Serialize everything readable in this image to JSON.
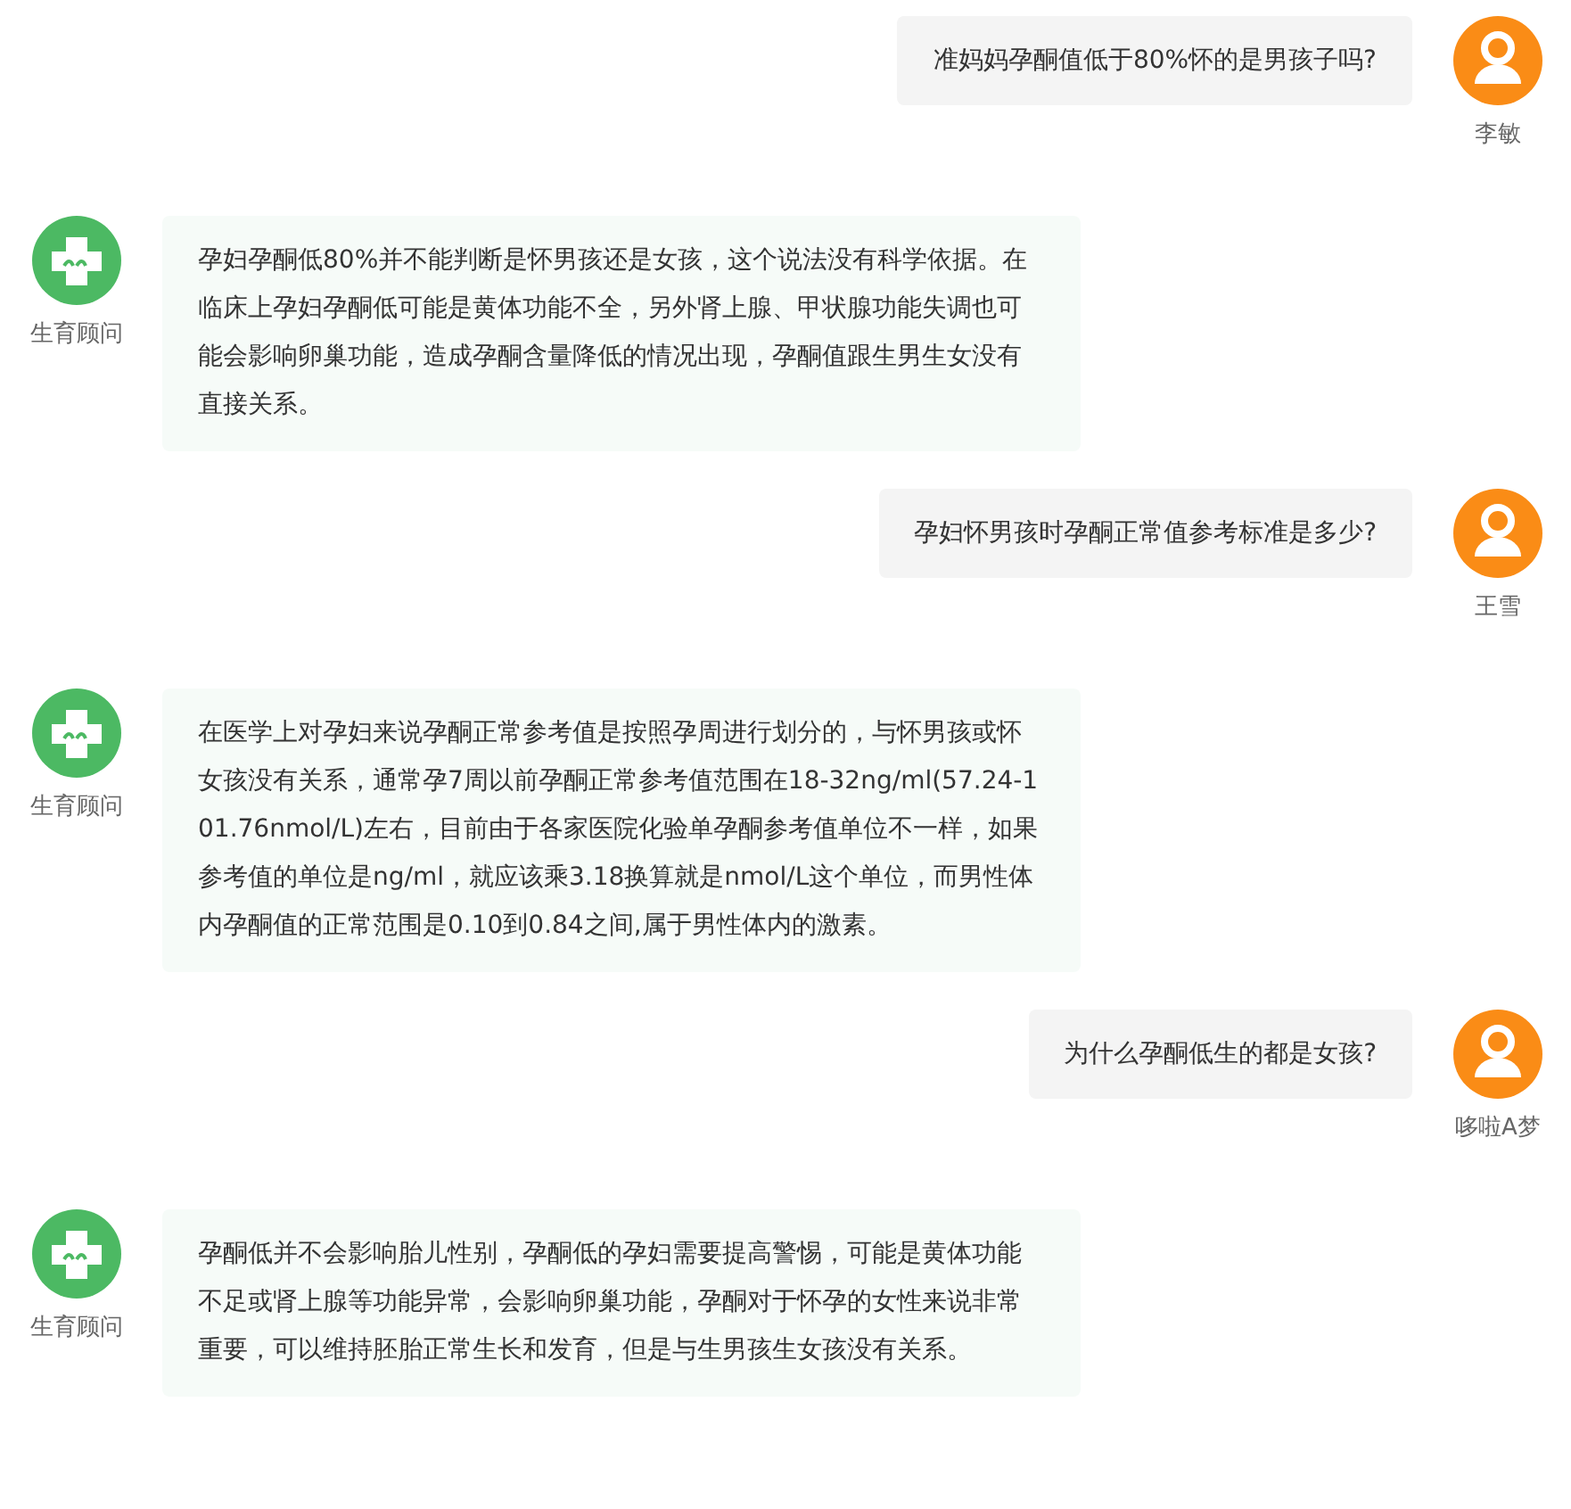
{
  "messages": [
    {
      "kind": "question",
      "text": "准妈妈孕酮值低于80%怀的是男孩子吗?",
      "author": "李敏"
    },
    {
      "kind": "answer",
      "text": "孕妇孕酮低80%并不能判断是怀男孩还是女孩，这个说法没有科学依据。在临床上孕妇孕酮低可能是黄体功能不全，另外肾上腺、甲状腺功能失调也可能会影响卵巢功能，造成孕酮含量降低的情况出现，孕酮值跟生男生女没有直接关系。",
      "author": "生育顾问"
    },
    {
      "kind": "question",
      "text": "孕妇怀男孩时孕酮正常值参考标准是多少?",
      "author": "王雪"
    },
    {
      "kind": "answer",
      "text": "在医学上对孕妇来说孕酮正常参考值是按照孕周进行划分的，与怀男孩或怀女孩没有关系，通常孕7周以前孕酮正常参考值范围在18-32ng/ml(57.24-101.76nmol/L)左右，目前由于各家医院化验单孕酮参考值单位不一样，如果参考值的单位是ng/ml，就应该乘3.18换算就是nmol/L这个单位，而男性体内孕酮值的正常范围是0.10到0.84之间,属于男性体内的激素。",
      "author": "生育顾问"
    },
    {
      "kind": "question",
      "text": "为什么孕酮低生的都是女孩?",
      "author": "哆啦A梦"
    },
    {
      "kind": "answer",
      "text": "孕酮低并不会影响胎儿性别，孕酮低的孕妇需要提高警惕，可能是黄体功能不足或肾上腺等功能异常，会影响卵巢功能，孕酮对于怀孕的女性来说非常重要，可以维持胚胎正常生长和发育，但是与生男孩生女孩没有关系。",
      "author": "生育顾问"
    }
  ]
}
